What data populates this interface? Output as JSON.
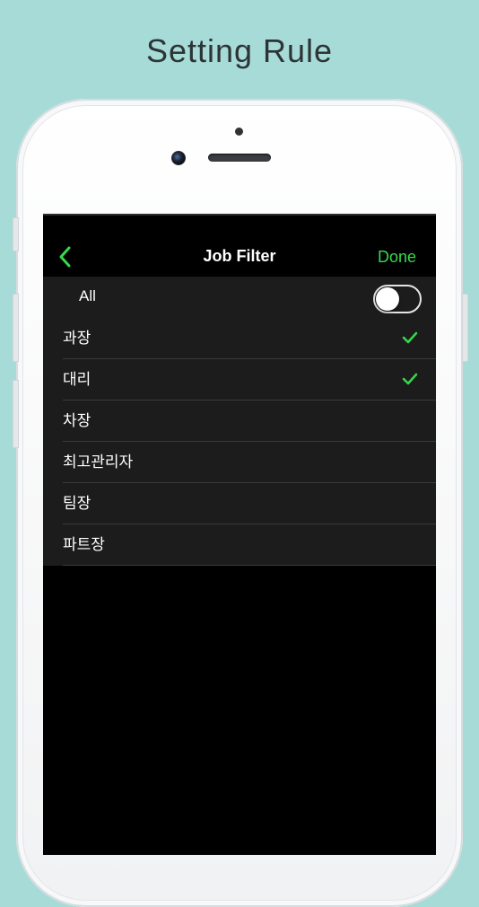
{
  "headline": "Setting Rule",
  "nav": {
    "title": "Job Filter",
    "done_label": "Done",
    "back_icon": "chevron-left-icon"
  },
  "all_row": {
    "label": "All",
    "toggle_on": false
  },
  "items": [
    {
      "label": "과장",
      "checked": true
    },
    {
      "label": "대리",
      "checked": true
    },
    {
      "label": "차장",
      "checked": false
    },
    {
      "label": "최고관리자",
      "checked": false
    },
    {
      "label": "팀장",
      "checked": false
    },
    {
      "label": "파트장",
      "checked": false
    }
  ],
  "colors": {
    "background": "#a7dbd7",
    "accent": "#35d94a",
    "screen": "#000000",
    "list_bg": "#1c1c1c"
  }
}
